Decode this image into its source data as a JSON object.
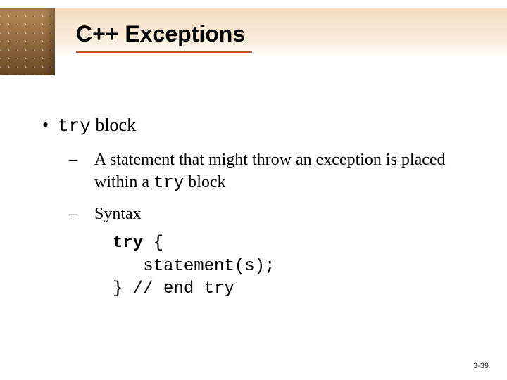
{
  "title": "C++ Exceptions",
  "bullet": {
    "label_code": "try",
    "label_rest": " block"
  },
  "sub1": {
    "prefix": "A statement that might throw an exception is placed within a ",
    "code": "try",
    "suffix": " block"
  },
  "sub2": {
    "label": "Syntax"
  },
  "code": {
    "line1a": "try",
    "line1b": " {",
    "line2": "   statement(s);",
    "line3": "} // end try"
  },
  "pagenum": "3-39"
}
